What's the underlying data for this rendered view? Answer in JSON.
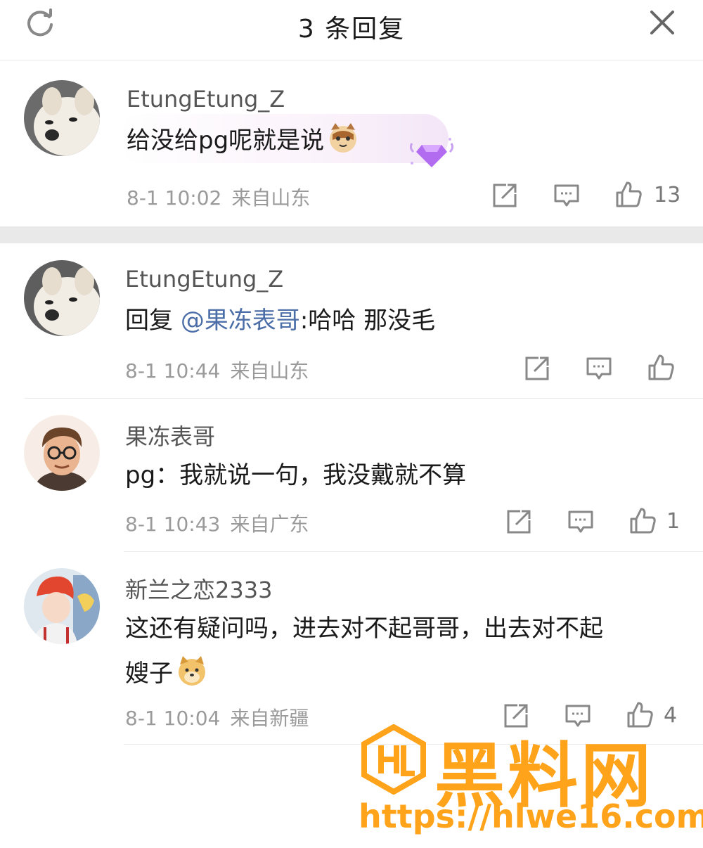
{
  "header": {
    "title": "3 条回复"
  },
  "comments": [
    {
      "username": "EtungEtung_Z",
      "text": "给没给pg呢就是说",
      "time": "8-1 10:02",
      "location": "来自山东",
      "likes": "13"
    },
    {
      "username": "EtungEtung_Z",
      "reply_prefix": "回复",
      "mention": "@果冻表哥",
      "text": ":哈哈 那没毛",
      "time": "8-1 10:44",
      "location": "来自山东",
      "likes": ""
    },
    {
      "username": "果冻表哥",
      "text": "pg：我就说一句，我没戴就不算",
      "time": "8-1 10:43",
      "location": "来自广东",
      "likes": "1"
    },
    {
      "username": "新兰之恋2333",
      "text_line1": "这还有疑问吗，进去对不起哥哥，出去对不起",
      "text_line2": "嫂子",
      "time": "8-1 10:04",
      "location": "来自新疆",
      "likes": "4"
    }
  ],
  "watermark": {
    "brand": "黑料网",
    "url": "https://hlwe16.com"
  },
  "colors": {
    "mention": "#4b6ea8",
    "watermark": "#ffa31a",
    "separator": "#e9e9e9"
  }
}
